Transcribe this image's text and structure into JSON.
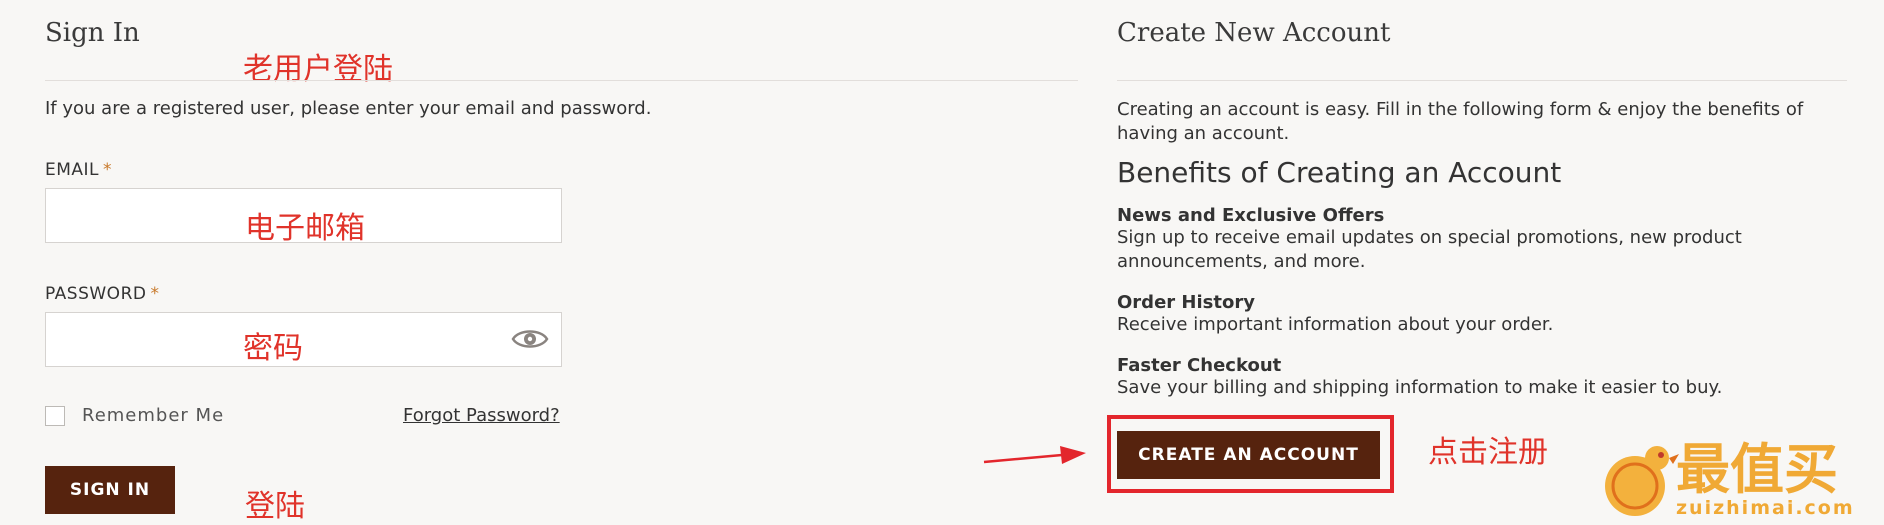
{
  "signin": {
    "title": "Sign In",
    "intro": "If you are a registered user, please enter your email and password.",
    "email_label": "EMAIL",
    "required_mark": "*",
    "password_label": "PASSWORD",
    "remember_label": "Remember Me",
    "forgot_label": "Forgot Password?",
    "button_label": "SIGN IN"
  },
  "annotations": {
    "old_user_login": "老用户登陆",
    "email_hint": "电子邮箱",
    "password_hint": "密码",
    "login_hint": "登陆",
    "register_hint": "点击注册"
  },
  "create_account": {
    "title": "Create New Account",
    "intro": "Creating an account is easy. Fill in the following form & enjoy the benefits of having an account.",
    "benefits_title": "Benefits of Creating an Account",
    "benefits": [
      {
        "title": "News and Exclusive Offers",
        "desc": "Sign up to receive email updates on special promotions, new product announcements, and more."
      },
      {
        "title": "Order History",
        "desc": "Receive important information about your order."
      },
      {
        "title": "Faster Checkout",
        "desc": "Save your billing and shipping information to make it easier to buy."
      }
    ],
    "button_label": "CREATE AN ACCOUNT"
  },
  "watermark": {
    "name": "最值买",
    "url": "zuizhimai.com"
  },
  "colors": {
    "button": "#56230e",
    "annotation": "#e0332a",
    "highlight": "#e3262c",
    "required": "#c8792a"
  }
}
